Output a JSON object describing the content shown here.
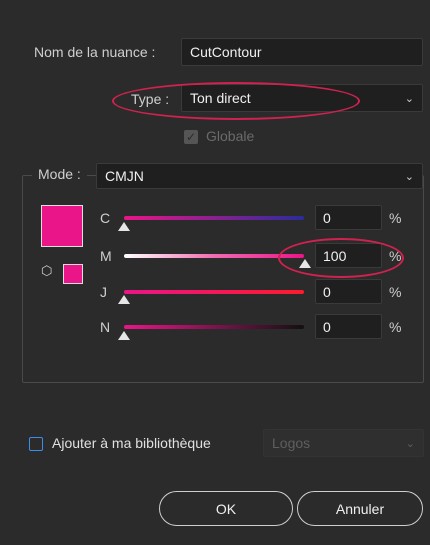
{
  "swatch_name": {
    "label": "Nom de la nuance :",
    "value": "CutContour"
  },
  "type": {
    "label": "Type :",
    "value": "Ton direct"
  },
  "global": {
    "label": "Globale",
    "checked": true
  },
  "mode": {
    "label": "Mode :",
    "value": "CMJN"
  },
  "channels": [
    {
      "letter": "C",
      "value": "0",
      "unit": "%",
      "level": 0
    },
    {
      "letter": "M",
      "value": "100",
      "unit": "%",
      "level": 100
    },
    {
      "letter": "J",
      "value": "0",
      "unit": "%",
      "level": 0
    },
    {
      "letter": "N",
      "value": "0",
      "unit": "%",
      "level": 0
    }
  ],
  "library": {
    "label": "Ajouter à ma bibliothèque",
    "select_value": "Logos",
    "checked": false
  },
  "buttons": {
    "ok": "OK",
    "cancel": "Annuler"
  },
  "colors": {
    "swatch": "#ea1588",
    "accent_annotation": "#d0224f",
    "checkbox_blue": "#3d8ee8"
  }
}
